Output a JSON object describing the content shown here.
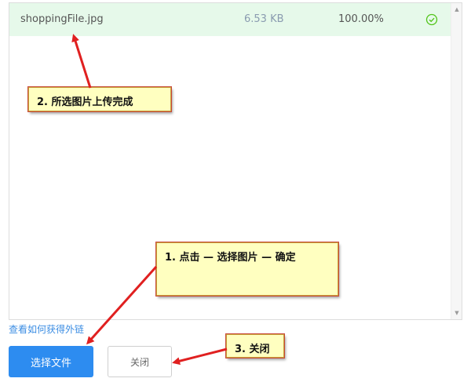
{
  "file_list": {
    "file_name": "shoppingFile.jpg",
    "file_size": "6.53 KB",
    "progress_text": "100.00%",
    "status_icon": "check-circle-icon",
    "status_color": "#52c41a"
  },
  "help_link": "查看如何获得外链",
  "buttons": {
    "select_file": "选择文件",
    "close": "关闭"
  },
  "annotations": {
    "step1": "1. 点击 — 选择图片 — 确定",
    "step2": "2. 所选图片上传完成",
    "step3": "3. 关闭"
  },
  "colors": {
    "accent": "#2d8cf0",
    "row_highlight": "#e6f9ea",
    "callout_bg": "#ffffc0",
    "arrow": "#e02020"
  }
}
